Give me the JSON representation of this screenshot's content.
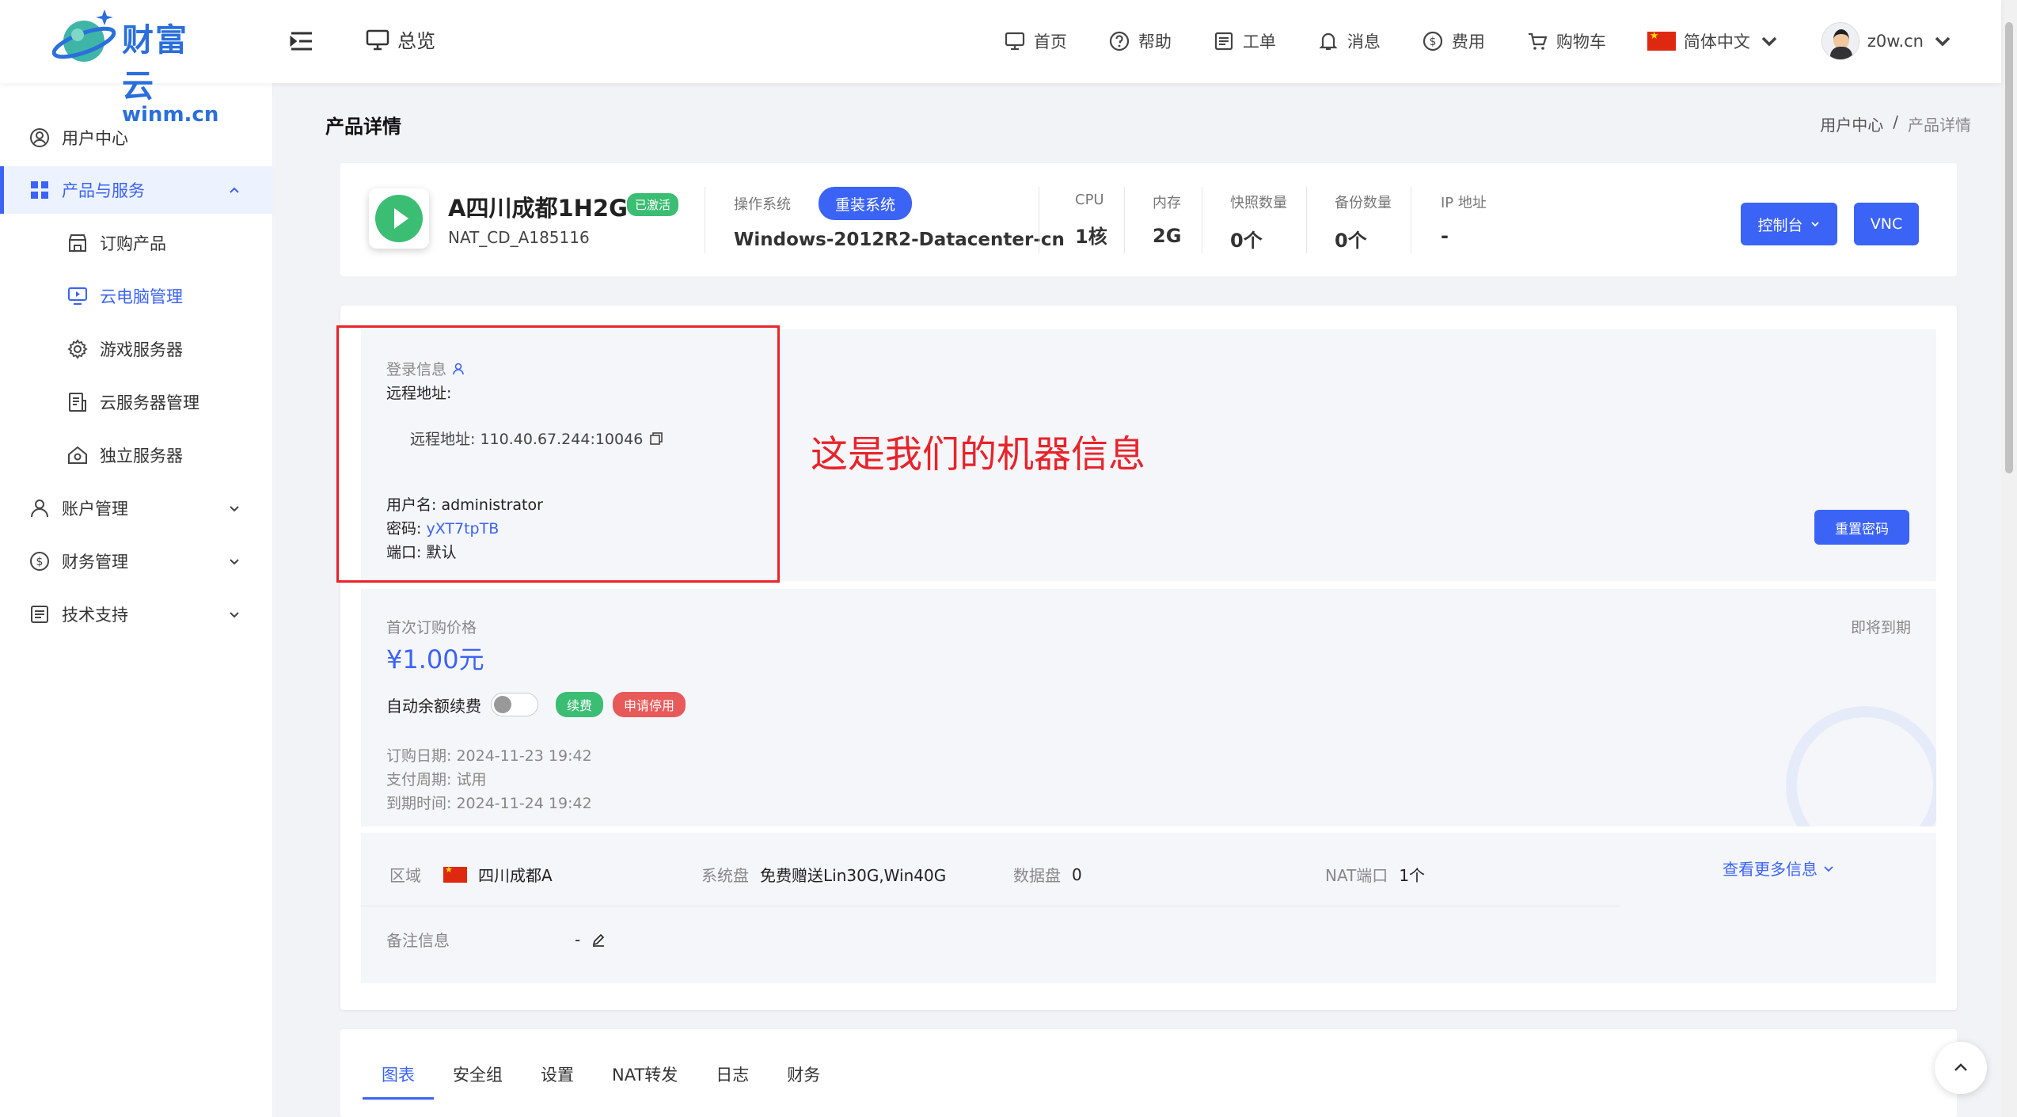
{
  "header": {
    "logo_cn": "财富云",
    "logo_en": "winm.cn",
    "overview": "总览",
    "nav": [
      "首页",
      "帮助",
      "工单",
      "消息",
      "费用",
      "购物车"
    ],
    "language": "简体中文",
    "user": "z0w.cn"
  },
  "sidebar": {
    "items": [
      "用户中心",
      "产品与服务",
      "账户管理",
      "财务管理",
      "技术支持"
    ],
    "sub_items": [
      "订购产品",
      "云电脑管理",
      "游戏服务器",
      "云服务器管理",
      "独立服务器"
    ]
  },
  "page": {
    "title": "产品详情",
    "breadcrumb": [
      "用户中心",
      "/",
      "产品详情"
    ]
  },
  "product": {
    "name": "A四川成都1H2G",
    "status": "已激活",
    "code": "NAT_CD_A185116",
    "os_label": "操作系统",
    "reinstall": "重装系统",
    "os": "Windows-2012R2-Datacenter-cn",
    "specs": [
      {
        "k": "CPU",
        "v": "1核"
      },
      {
        "k": "内存",
        "v": "2G"
      },
      {
        "k": "快照数量",
        "v": "0个"
      },
      {
        "k": "备份数量",
        "v": "0个"
      },
      {
        "k": "IP 地址",
        "v": "-"
      }
    ],
    "console": "控制台",
    "vnc": "VNC"
  },
  "login": {
    "title": "登录信息",
    "remote_label": "远程地址:",
    "remote_line": "远程地址:   110.40.67.244:10046",
    "username": "用户名:  administrator",
    "password_label": "密码:",
    "password": "yXT7tpTB",
    "port": "端口:  默认",
    "reset": "重置密码",
    "annotation": "这是我们的机器信息"
  },
  "billing": {
    "first_price_label": "首次订购价格",
    "price": "¥1.00元",
    "expire_soon": "即将到期",
    "auto_renew": "自动余额续费",
    "renew": "续费",
    "stop": "申请停用",
    "order_date": "订购日期:  2024-11-23 19:42",
    "cycle": "支付周期:  试用",
    "expire_date": "到期时间:  2024-11-24 19:42"
  },
  "region": {
    "region_k": "区域",
    "region_v": "四川成都A",
    "disk_k": "系统盘",
    "disk_v": "免费赠送Lin30G,Win40G",
    "data_k": "数据盘",
    "data_v": "0",
    "nat_k": "NAT端口",
    "nat_v": "1个",
    "more": "查看更多信息",
    "note_k": "备注信息",
    "note_v": "-"
  },
  "tabs": [
    "图表",
    "安全组",
    "设置",
    "NAT转发",
    "日志",
    "财务"
  ]
}
